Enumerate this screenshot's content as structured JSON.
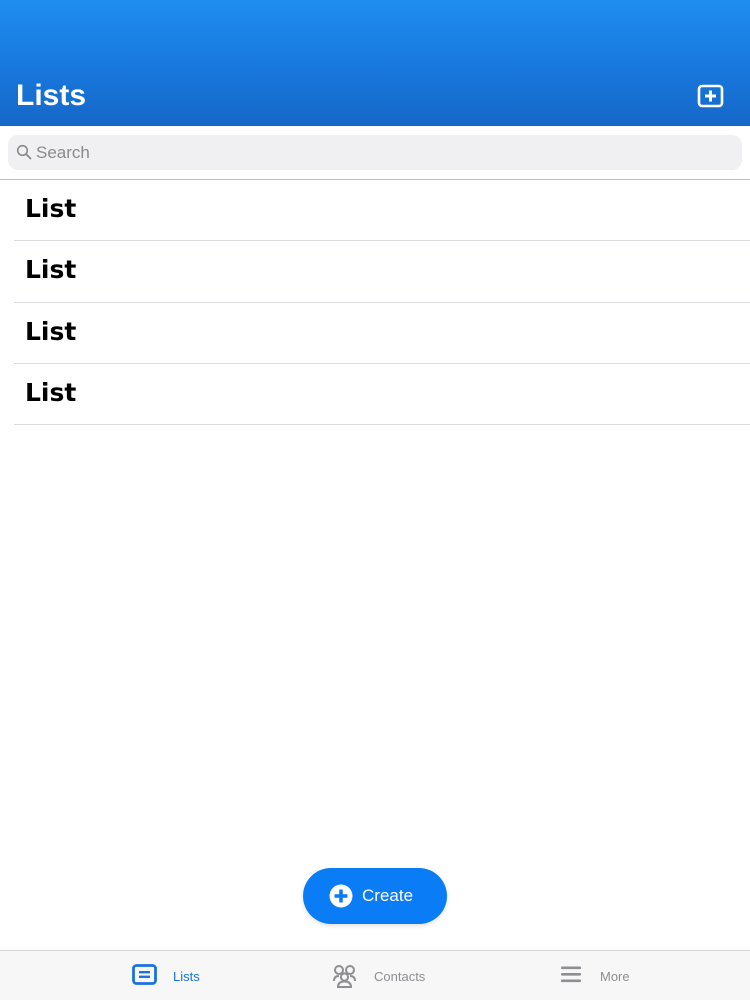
{
  "header": {
    "title": "Lists",
    "add_icon": "plus-square-icon"
  },
  "search": {
    "placeholder": "Search",
    "value": "",
    "icon": "search-icon"
  },
  "lists": {
    "items": [
      {
        "label": "List"
      },
      {
        "label": "List"
      },
      {
        "label": "List"
      },
      {
        "label": "List"
      }
    ]
  },
  "create_button": {
    "label": "Create",
    "icon": "plus-circle-icon"
  },
  "tabbar": {
    "tabs": [
      {
        "label": "Lists",
        "icon": "lists-icon",
        "active": true
      },
      {
        "label": "Contacts",
        "icon": "contacts-icon",
        "active": false
      },
      {
        "label": "More",
        "icon": "menu-icon",
        "active": false
      }
    ]
  },
  "colors": {
    "header_blue": "#1877dc",
    "accent_blue": "#0a7cf5",
    "active_tab": "#1a73d9",
    "inactive_tab": "#8e8e93"
  }
}
